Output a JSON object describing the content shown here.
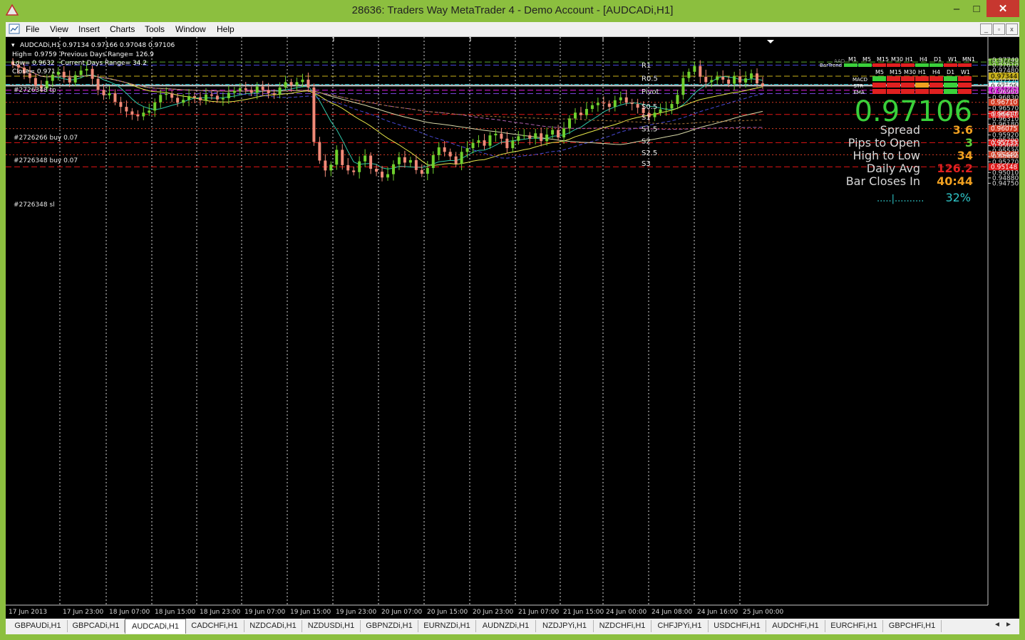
{
  "window": {
    "title": "28636: Traders Way MetaTrader 4 - Demo Account - [AUDCADi,H1]",
    "min_label": "–",
    "max_label": "□",
    "close_label": "✕"
  },
  "menu": [
    "File",
    "View",
    "Insert",
    "Charts",
    "Tools",
    "Window",
    "Help"
  ],
  "mdi_buttons": [
    "_",
    "▫",
    "x"
  ],
  "chart_info": {
    "header": "AUDCADi,H1  0.97134 0.97166 0.97048 0.97106",
    "high": "High= 0.9759",
    "low": "Low= 0.9632",
    "close": "Close= 0.971",
    "prev_range": "Previous Days Range= 126.9",
    "curr_range": "Current Days Range= 34.2"
  },
  "order_labels": [
    "#2726348 tp",
    "#2726266 buy 0.07",
    "#2726348 buy 0.07",
    "#2726348 sl"
  ],
  "pivot_labels": [
    "R1",
    "R0.5",
    "Pivot",
    "S0.5",
    "S1",
    "S1.5",
    "S2",
    "S2.5",
    "S3"
  ],
  "price_axis": [
    "0.97740",
    "0.97610",
    "0.97480",
    "0.97220",
    "0.97090",
    "0.96960",
    "0.96830",
    "0.96570",
    "0.96440",
    "0.96310",
    "0.96180",
    "0.95920",
    "0.95790",
    "0.95660",
    "0.95530",
    "0.95400",
    "0.95270",
    "0.95010",
    "0.94880",
    "0.94750"
  ],
  "price_tags": [
    {
      "label": "0.97686",
      "color": "#6fb934",
      "text_color": "#000000"
    },
    {
      "label": "0.97344",
      "color": "#c7b01a",
      "text_color": "#000000"
    },
    {
      "label": "0.97142",
      "color": "#19c8d8",
      "text_color": "#000000"
    },
    {
      "label": "0.97106",
      "color": "#ffffff",
      "text_color": "#000000"
    },
    {
      "label": "0.97002",
      "color": "#e01ce0",
      "text_color": "#000000"
    },
    {
      "label": "0.96710",
      "color": "#d43b22",
      "text_color": "#ffffff"
    },
    {
      "label": "0.96417",
      "color": "#e01515",
      "text_color": "#ffffff"
    },
    {
      "label": "0.96075",
      "color": "#d43b22",
      "text_color": "#ffffff"
    },
    {
      "label": "0.95733",
      "color": "#e01515",
      "text_color": "#ffffff"
    },
    {
      "label": "0.95440",
      "color": "#d43b22",
      "text_color": "#ffffff"
    },
    {
      "label": "0.95148",
      "color": "#e01515",
      "text_color": "#ffffff"
    }
  ],
  "time_axis": [
    "17 Jun 2013",
    "17 Jun 23:00",
    "18 Jun 07:00",
    "18 Jun 15:00",
    "18 Jun 23:00",
    "19 Jun 07:00",
    "19 Jun 15:00",
    "19 Jun 23:00",
    "20 Jun 07:00",
    "20 Jun 15:00",
    "20 Jun 23:00",
    "21 Jun 07:00",
    "21 Jun 15:00",
    "24 Jun 00:00",
    "24 Jun 08:00",
    "24 Jun 16:00",
    "25 Jun 00:00"
  ],
  "panel": {
    "big_price": "0.97106",
    "rows": [
      {
        "label": "Spread",
        "value": "3.6",
        "color": "#f0a020"
      },
      {
        "label": "Pips to Open",
        "value": "3",
        "color": "#5fd03a"
      },
      {
        "label": "High to Low",
        "value": "34",
        "color": "#f0a020"
      },
      {
        "label": "Daily Avg",
        "value": "126.2",
        "color": "#e02020"
      },
      {
        "label": "Bar Closes In",
        "value": "40:44",
        "color": "#f0a020"
      }
    ],
    "progress_text": ".....|..........",
    "progress_pct": "32%",
    "progress_fraction": 0.32,
    "bartrend_label": "BarTrend",
    "aad_label": "AAD",
    "tf_top": [
      "M1",
      "M5",
      "M15",
      "M30",
      "H1",
      "H4",
      "D1",
      "W1",
      "MN1"
    ],
    "tf_bottom": [
      "M5",
      "M15",
      "M30",
      "H1",
      "H4",
      "D1",
      "W1"
    ],
    "ind_labels": [
      "MACD",
      "STR",
      "EMA"
    ]
  },
  "tabs": [
    "GBPAUDi,H1",
    "GBPCADi,H1",
    "AUDCADi,H1",
    "CADCHFi,H1",
    "NZDCADi,H1",
    "NZDUSDi,H1",
    "GBPNZDi,H1",
    "EURNZDi,H1",
    "AUDNZDi,H1",
    "NZDJPYi,H1",
    "NZDCHFi,H1",
    "CHFJPYi,H1",
    "USDCHFi,H1",
    "AUDCHFi,H1",
    "EURCHFi,H1",
    "GBPCHFi,H1"
  ],
  "active_tab": "AUDCADi,H1",
  "tab_scroll": [
    "◄",
    "►"
  ],
  "colors": {
    "bull": "#6fd02d",
    "bear": "#f08a78",
    "background": "#000000",
    "window_frame": "#8cbf3f"
  }
}
